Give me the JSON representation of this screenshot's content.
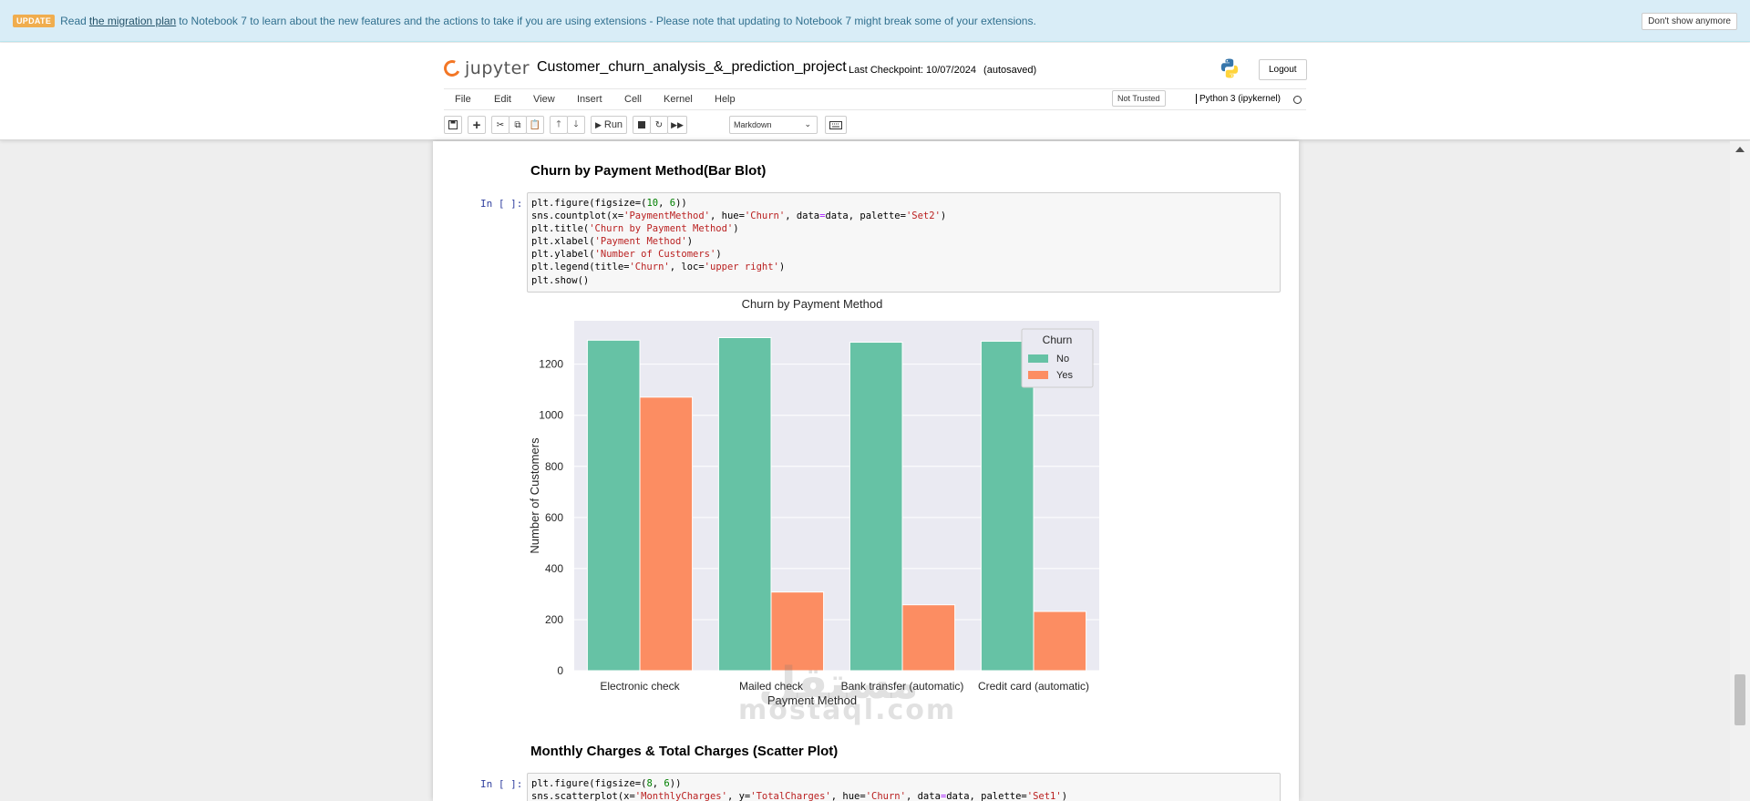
{
  "banner": {
    "tag": "UPDATE",
    "text_before": "Read",
    "link": "the migration plan",
    "text_after": "to Notebook 7 to learn about the new features and the actions to take if you are using extensions - Please note that updating to Notebook 7 might break some of your extensions.",
    "dismiss": "Don't show anymore"
  },
  "header": {
    "logo_text": "jupyter",
    "notebook_name": "Customer_churn_analysis_&_prediction_project",
    "checkpoint": "Last Checkpoint: 10/07/2024",
    "autosaved": "(autosaved)",
    "logout": "Logout",
    "menu": [
      "File",
      "Edit",
      "View",
      "Insert",
      "Cell",
      "Kernel",
      "Help"
    ],
    "trusted": "Not Trusted",
    "kernel": "Python 3 (ipykernel)",
    "run_label": "Run",
    "cell_type": "Markdown"
  },
  "cells": {
    "md1": "Churn by Payment Method(Bar Blot)",
    "prompt1": "In [ ]:",
    "md2": "Monthly Charges & Total Charges (Scatter Plot)",
    "prompt2": "In [ ]:"
  },
  "watermark": {
    "arabic": "مستقل",
    "latin": "mostaql.com"
  },
  "chart_data": {
    "type": "bar",
    "title": "Churn by Payment Method",
    "xlabel": "Payment Method",
    "ylabel": "Number of Customers",
    "categories": [
      "Electronic check",
      "Mailed check",
      "Bank transfer (automatic)",
      "Credit card (automatic)"
    ],
    "series": [
      {
        "name": "No",
        "values": [
          1294,
          1304,
          1286,
          1290
        ],
        "color": "#66c2a5"
      },
      {
        "name": "Yes",
        "values": [
          1071,
          308,
          258,
          232
        ],
        "color": "#fc8d62"
      }
    ],
    "ylim": [
      0,
      1370
    ],
    "yticks": [
      0,
      200,
      400,
      600,
      800,
      1000,
      1200
    ],
    "legend_title": "Churn",
    "legend_position": "upper right",
    "background": "#eaeaf2",
    "grid": true
  }
}
